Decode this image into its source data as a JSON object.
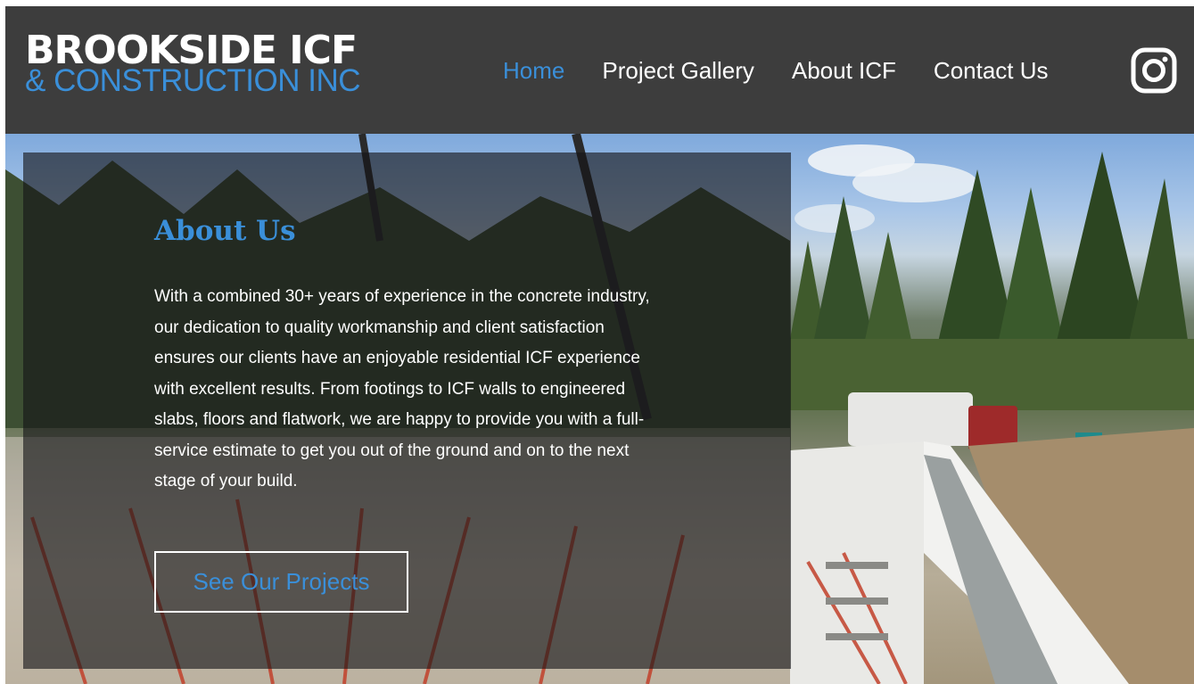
{
  "logo": {
    "line1": "BROOKSIDE ICF",
    "line2": "& CONSTRUCTION INC"
  },
  "nav": {
    "items": [
      {
        "label": "Home",
        "active": true
      },
      {
        "label": "Project Gallery",
        "active": false
      },
      {
        "label": "About ICF",
        "active": false
      },
      {
        "label": "Contact Us",
        "active": false
      }
    ],
    "social_icon": "instagram-icon"
  },
  "hero": {
    "title": "About Us",
    "body": "With a combined 30+ years of experience in the concrete industry, our dedication to quality workmanship and client satisfaction ensures our clients have an enjoyable residential ICF experience with excellent results. From footings to ICF walls to engineered slabs, floors and flatwork, we are happy to provide you with a full-service estimate to get you out of the ground and on to the next stage of your build.",
    "cta_label": "See Our Projects",
    "background_image": "construction-site-photo"
  },
  "colors": {
    "header_bg": "#3d3d3d",
    "accent": "#3a8fd9",
    "text_light": "#ffffff"
  }
}
